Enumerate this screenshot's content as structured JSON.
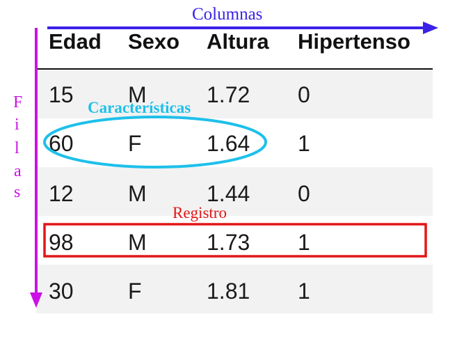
{
  "annotations": {
    "columns_label": "Columnas",
    "rows_label_letters": [
      "F",
      "i",
      "l",
      "a",
      "s"
    ],
    "feature_label": "Características",
    "record_label": "Registro"
  },
  "table": {
    "headers": [
      "Edad",
      "Sexo",
      "Altura",
      "Hipertenso"
    ],
    "rows": [
      [
        "15",
        "M",
        "1.72",
        "0"
      ],
      [
        "60",
        "F",
        "1.64",
        "1"
      ],
      [
        "12",
        "M",
        "1.44",
        "0"
      ],
      [
        "98",
        "M",
        "1.73",
        "1"
      ],
      [
        "30",
        "F",
        "1.81",
        "1"
      ]
    ]
  },
  "colors": {
    "columns_arrow": "#3b22e6",
    "rows_arrow": "#cc11e6",
    "feature_highlight": "#1ec0ea",
    "record_highlight": "#e31616",
    "row_shade": "#f2f2f2"
  },
  "highlights": {
    "feature_cells": "60, F, 1.64",
    "record_row": "98, M, 1.73, 1"
  }
}
